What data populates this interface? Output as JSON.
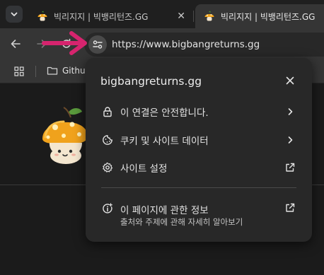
{
  "tabs": [
    {
      "title": "빅리지지 | 빅뱅리턴즈.GG",
      "active": false
    },
    {
      "title": "빅리지지 | 빅뱅리턴즈.GG",
      "active": true
    }
  ],
  "toolbar": {
    "url": "https://www.bigbangreturns.gg"
  },
  "bookmarks": [
    {
      "label": "Githu",
      "icon": "folder-icon"
    }
  ],
  "popup": {
    "site": "bigbangreturns.gg",
    "connection_label": "이 연결은 안전합니다.",
    "cookies_label": "쿠키 및 사이트 데이터",
    "settings_label": "사이트 설정",
    "about_label": "이 페이지에 관한 정보",
    "about_sub": "출처와 주제에 관해 자세히 알아보기"
  },
  "colors": {
    "annotation_arrow": "#d6246e",
    "popup_bg": "#282828",
    "toolbar_bg": "#353535",
    "mascot_cap": "#f0a21c"
  },
  "icons": [
    "tab-search-icon",
    "back-icon",
    "forward-icon",
    "reload-icon",
    "site-info-icon",
    "apps-grid-icon",
    "folder-icon",
    "close-icon",
    "lock-icon",
    "cookie-icon",
    "gear-icon",
    "info-icon",
    "chevron-right-icon",
    "open-external-icon"
  ]
}
